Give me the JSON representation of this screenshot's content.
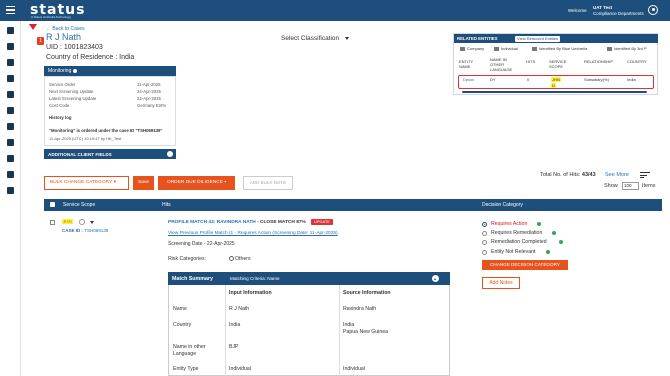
{
  "header": {
    "logo": "status",
    "logo_sub": "A Status Umbrella Technology",
    "welcome": "Welcome",
    "user_name": "UAT Test",
    "user_dept": "Compliance Departments"
  },
  "case": {
    "back": "Back to Cases",
    "name": "R J Nath",
    "uid": "UID : 1001823403",
    "country": "Country of Residence : India",
    "notif_count": "1"
  },
  "classification": {
    "label": "Select Classification"
  },
  "monitoring": {
    "title": "Monitoring",
    "rows": [
      {
        "label": "Service Order",
        "value": "11-Apr-2025"
      },
      {
        "label": "Next Screening Update",
        "value": "24-Apr-2025"
      },
      {
        "label": "Latest Screening Update",
        "value": "22-Apr-2025"
      },
      {
        "label": "Cost Code",
        "value": "Germany Ent%"
      }
    ],
    "history_title": "History log",
    "history_msg": "\"Monitoring\" is ordered under the case ID \"TSH069139\"",
    "history_meta": "11-Apr-2025 (UTC) 10:19:47 by HK_Test"
  },
  "additional_fields": {
    "label": "ADDITIONAL CLIENT FIELDS"
  },
  "related": {
    "title": "RELATED ENTITIES",
    "removed_btn": "View Removed Entities",
    "legend": [
      "Company",
      "Individual",
      "Identified By Blue Umbrella",
      "Identified By 3rd P"
    ],
    "columns": [
      "ENTITY NAME",
      "NAME IN OTHER LANGUAGE",
      "HITS",
      "SERVICE SCOPE",
      "RELATIONSHIP",
      "COUNTRY"
    ],
    "row": {
      "name": "Dyson",
      "other": "DY",
      "hits": "0",
      "scope": "JHN",
      "scope2": "D",
      "relationship": "Subsidiary(%)",
      "country": "India"
    }
  },
  "actions": {
    "bulk_change": "BULK CHANGE CATEGORY",
    "save": "Save",
    "order_dd": "ORDER DUE DILIGENCE",
    "add_bulk": "ADD BULK NOTE"
  },
  "hits_summary": {
    "total_prefix": "Total No. of Hits:",
    "total": "43/43",
    "see_more": "See More",
    "show": "Show",
    "show_value": "100",
    "items": "Items"
  },
  "table": {
    "headers": [
      "Service Scope",
      "Hits",
      "Decision Category"
    ]
  },
  "row": {
    "scope_tag": "JHN",
    "case_id_label": "CASE ID :",
    "case_id": "TSH069139",
    "profile_match": "PROFILE MATCH 43: RAVINDRA NATH",
    "close_match": "- CLOSE MATCH 87%",
    "badge": "UPDATE",
    "view_prev": "View Previous Profile Match (1 - Requires Action (Screening Date: 11-Apr-2025)",
    "screening": "Screening Date - 22-Apr-2025",
    "risk_label": "Risk Categories:",
    "risk_value": "Others"
  },
  "match_summary": {
    "title": "Match Summary",
    "criteria": "Matching Criteria: Name",
    "col_input": "Input Information",
    "col_source": "Source Information",
    "rows": [
      {
        "label": "Name",
        "input": "R J Nath",
        "source": "Ravindra Nath"
      },
      {
        "label": "Country",
        "input": "India",
        "source": "India"
      },
      {
        "label": "",
        "input": "",
        "source": "Papua New Guinea"
      },
      {
        "label": "Name in other",
        "input": "BJP",
        "source": ""
      },
      {
        "label": "Language",
        "input": "",
        "source": ""
      },
      {
        "label": "Entity Type",
        "input": "Individual",
        "source": "Individual"
      }
    ]
  },
  "decision": {
    "options": [
      "Requires Action",
      "Requires Remediation",
      "Remediation Completed",
      "Entity Not Relevant"
    ],
    "change_btn": "CHANGE DECISION CATEGORY",
    "add_notes": "Add Notes"
  }
}
